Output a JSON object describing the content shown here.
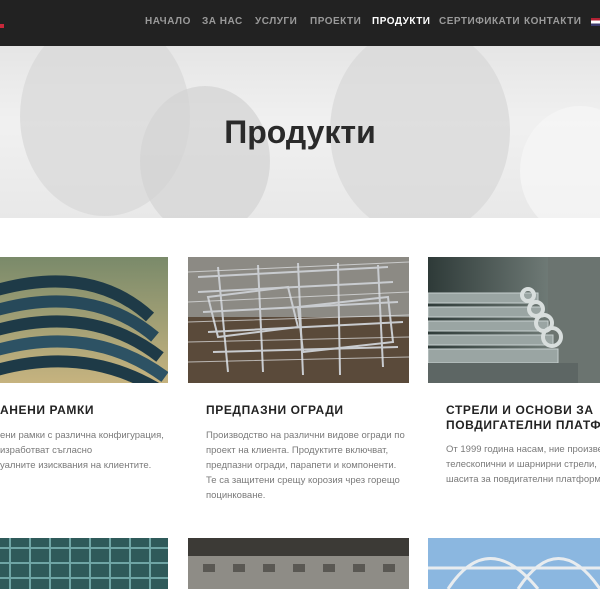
{
  "nav": {
    "items": [
      {
        "label": "НАЧАЛО"
      },
      {
        "label": "ЗА НАС"
      },
      {
        "label": "УСЛУГИ"
      },
      {
        "label": "ПРОЕКТИ"
      },
      {
        "label": "ПРОДУКТИ"
      },
      {
        "label": "СЕРТИФИКАТИ"
      },
      {
        "label": "КОНТАКТИ"
      }
    ],
    "active": "ПРОДУКТИ",
    "language_flag": "us-flag-icon"
  },
  "hero": {
    "title": "Продукти"
  },
  "products": [
    {
      "title": "АНЕНИ РАМКИ",
      "lines": [
        "ени рамки с различна конфигурация,",
        "изработват съгласно",
        "уалните изисквания на клиентите."
      ]
    },
    {
      "title": "ПРЕДПАЗНИ ОГРАДИ",
      "lines": [
        "Производство на различни видове огради по",
        "проект на клиента. Продуктите включват,",
        "предпазни огради, парапети и компоненти.",
        "Те са защитени срещу корозия чрез горещо",
        "поцинковане."
      ]
    },
    {
      "title_lines": [
        "СТРЕЛИ И ОСНОВИ ЗА",
        "ПОВДИГАТЕЛНИ ПЛАТФОРМ"
      ],
      "lines": [
        "От 1999 година насам, ние произвеж",
        "телескопични и шарнирни стрели, ос",
        "шасита за повдигателни платформи."
      ]
    }
  ],
  "colors": {
    "nav_bg": "#222222",
    "nav_text": "#9a9a9a",
    "nav_active": "#ffffff",
    "title_text": "#222222",
    "body_text": "#7a7a7a",
    "accent": "#c8283a"
  }
}
